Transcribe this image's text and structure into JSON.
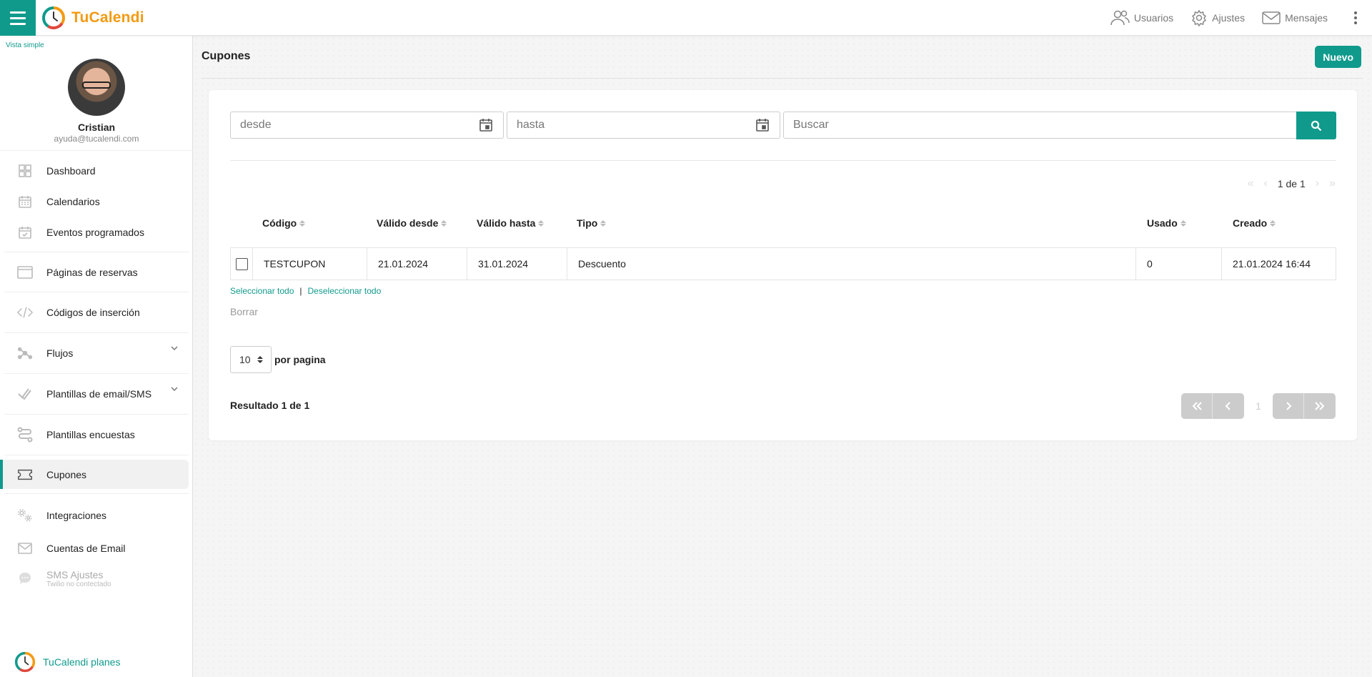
{
  "app": {
    "logo_tu": "Tu",
    "logo_calend": "Calend",
    "logo_i": "i"
  },
  "topnav": {
    "users": "Usuarios",
    "settings": "Ajustes",
    "messages": "Mensajes"
  },
  "sidebar": {
    "view_toggle": "Vista simple",
    "profile": {
      "name": "Cristian",
      "email": "ayuda@tucalendi.com"
    },
    "items": [
      {
        "label": "Dashboard",
        "icon": "dashboard-icon"
      },
      {
        "label": "Calendarios",
        "icon": "calendar-icon"
      },
      {
        "label": "Eventos programados",
        "icon": "calendar-check-icon"
      },
      {
        "label": "Páginas de reservas",
        "icon": "browser-window-icon"
      },
      {
        "label": "Códigos de inserción",
        "icon": "code-icon"
      },
      {
        "label": "Flujos",
        "icon": "workflow-icon"
      },
      {
        "label": "Plantillas de email/SMS",
        "icon": "double-check-icon"
      },
      {
        "label": "Plantillas encuestas",
        "icon": "survey-icon"
      },
      {
        "label": "Cupones",
        "icon": "ticket-icon"
      },
      {
        "label": "Integraciones",
        "icon": "gears-icon"
      },
      {
        "label": "Cuentas de Email",
        "icon": "envelope-icon"
      },
      {
        "label": "SMS Ajustes",
        "sub": "Twilio no contectado",
        "icon": "chat-bubble-icon"
      }
    ],
    "plans": "TuCalendi planes"
  },
  "page": {
    "title": "Cupones",
    "new_button": "Nuevo"
  },
  "filters": {
    "from_placeholder": "desde",
    "to_placeholder": "hasta",
    "search_placeholder": "Buscar"
  },
  "pager_top": {
    "text": "1 de 1"
  },
  "table": {
    "columns": [
      "Código",
      "Válido desde",
      "Válido hasta",
      "Tipo",
      "Usado",
      "Creado"
    ],
    "rows": [
      {
        "code": "TESTCUPON",
        "valid_from": "21.01.2024",
        "valid_to": "31.01.2024",
        "type": "Descuento",
        "used": "0",
        "created": "21.01.2024 16:44"
      }
    ]
  },
  "selection": {
    "select_all": "Seleccionar todo",
    "separator": "|",
    "deselect_all": "Deseleccionar todo",
    "delete": "Borrar"
  },
  "per_page": {
    "value": "10",
    "label": "por pagina"
  },
  "result": "Resultado 1 de 1",
  "pager_bottom": {
    "current": "1"
  },
  "colors": {
    "accent": "#109a8c",
    "logo": "#f39a12"
  }
}
